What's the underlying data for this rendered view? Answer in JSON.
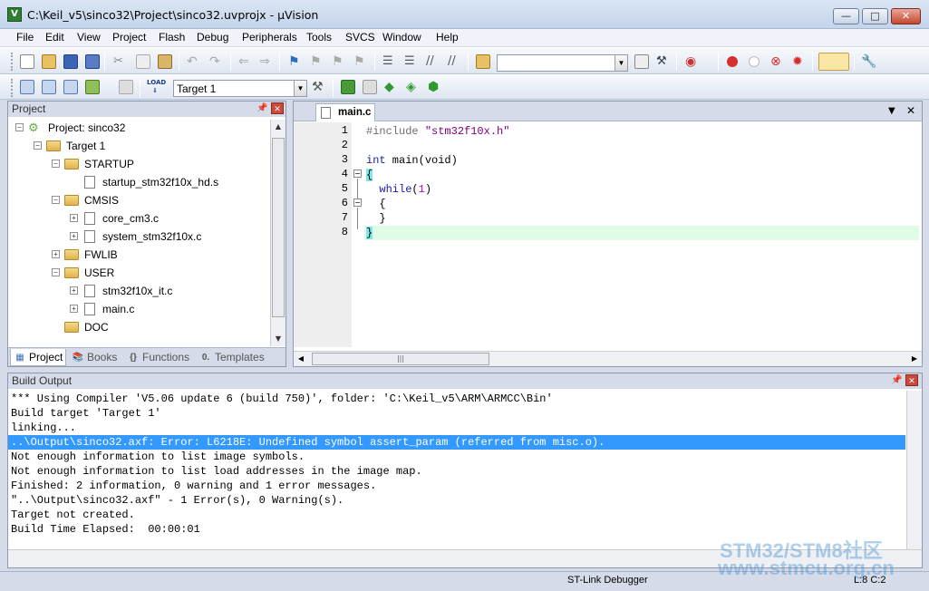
{
  "window": {
    "title": "C:\\Keil_v5\\sinco32\\Project\\sinco32.uvprojx - µVision"
  },
  "menu": [
    "File",
    "Edit",
    "View",
    "Project",
    "Flash",
    "Debug",
    "Peripherals",
    "Tools",
    "SVCS",
    "Window",
    "Help"
  ],
  "toolbar": {
    "find_combo_value": "",
    "target_combo_value": "Target 1"
  },
  "project_panel": {
    "title": "Project",
    "tree": [
      {
        "label": "Project: sinco32",
        "level": 0,
        "kind": "project",
        "expander": "-"
      },
      {
        "label": "Target 1",
        "level": 1,
        "kind": "folder",
        "expander": "-"
      },
      {
        "label": "STARTUP",
        "level": 2,
        "kind": "folder",
        "expander": "-"
      },
      {
        "label": "startup_stm32f10x_hd.s",
        "level": 3,
        "kind": "file",
        "expander": ""
      },
      {
        "label": "CMSIS",
        "level": 2,
        "kind": "folder",
        "expander": "-"
      },
      {
        "label": "core_cm3.c",
        "level": 3,
        "kind": "file",
        "expander": "+"
      },
      {
        "label": "system_stm32f10x.c",
        "level": 3,
        "kind": "file",
        "expander": "+"
      },
      {
        "label": "FWLIB",
        "level": 2,
        "kind": "folder",
        "expander": "+"
      },
      {
        "label": "USER",
        "level": 2,
        "kind": "folder",
        "expander": "-"
      },
      {
        "label": "stm32f10x_it.c",
        "level": 3,
        "kind": "file",
        "expander": "+"
      },
      {
        "label": "main.c",
        "level": 3,
        "kind": "file",
        "expander": "+"
      },
      {
        "label": "DOC",
        "level": 2,
        "kind": "folder",
        "expander": ""
      }
    ],
    "tabs": [
      {
        "label": "Project",
        "icon": "project-tab-icon"
      },
      {
        "label": "Books",
        "icon": "books-icon"
      },
      {
        "label": "Functions",
        "icon": "functions-icon"
      },
      {
        "label": "Templates",
        "icon": "templates-icon"
      }
    ]
  },
  "editor": {
    "tab_label": "main.c",
    "lines": [
      {
        "n": "1",
        "text": "#include \"stm32f10x.h\""
      },
      {
        "n": "2",
        "text": ""
      },
      {
        "n": "3",
        "text": "int main(void)"
      },
      {
        "n": "4",
        "text": "{"
      },
      {
        "n": "5",
        "text": "  while(1)"
      },
      {
        "n": "6",
        "text": "  {"
      },
      {
        "n": "7",
        "text": "  }"
      },
      {
        "n": "8",
        "text": "}"
      }
    ],
    "cursor_line": 8
  },
  "build_output": {
    "title": "Build Output",
    "lines": [
      "*** Using Compiler 'V5.06 update 6 (build 750)', folder: 'C:\\Keil_v5\\ARM\\ARMCC\\Bin'",
      "Build target 'Target 1'",
      "linking...",
      "..\\Output\\sinco32.axf: Error: L6218E: Undefined symbol assert_param (referred from misc.o).",
      "Not enough information to list image symbols.",
      "Not enough information to list load addresses in the image map.",
      "Finished: 2 information, 0 warning and 1 error messages.",
      "\"..\\Output\\sinco32.axf\" - 1 Error(s), 0 Warning(s).",
      "Target not created.",
      "Build Time Elapsed:  00:00:01"
    ],
    "selected_line": 3
  },
  "status": {
    "debugger": "ST-Link Debugger",
    "position": "L:8 C:2"
  },
  "watermark": {
    "line1": "STM32/STM8社区",
    "line2": "www.stmcu.org.cn"
  }
}
